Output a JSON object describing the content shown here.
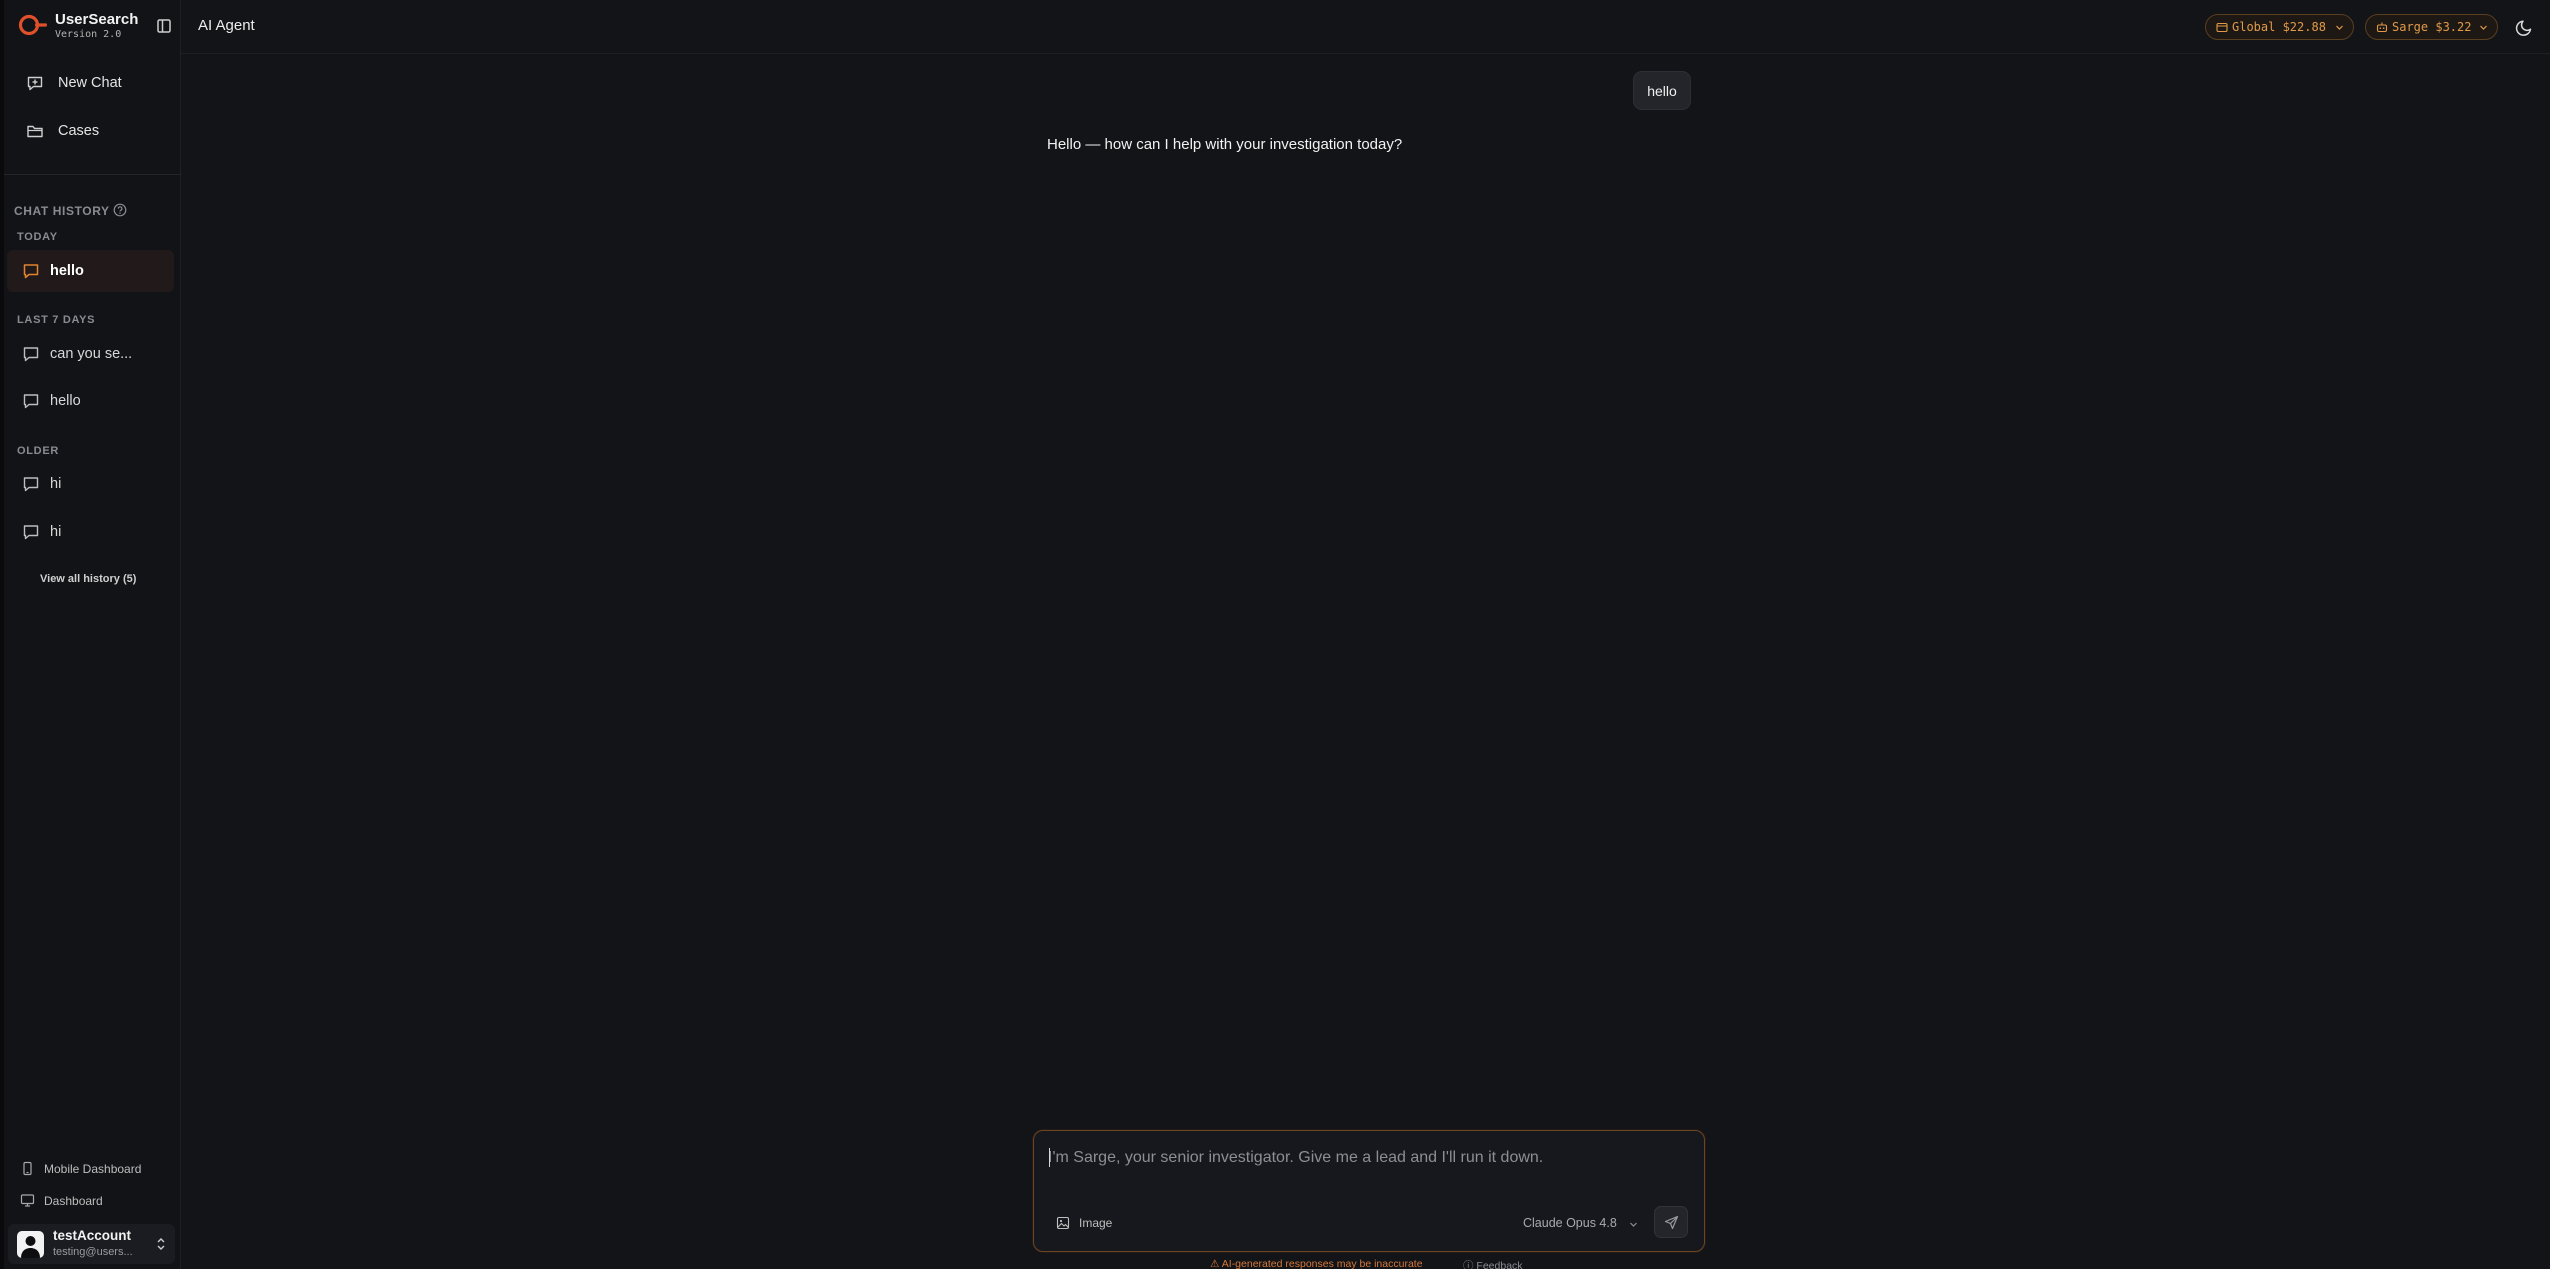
{
  "brand": {
    "name": "UserSearch",
    "version": "Version 2.0",
    "accent_color": "#e0502a"
  },
  "header": {
    "title": "AI Agent",
    "global_balance": "Global $22.88",
    "agent_balance": "Sarge $3.22",
    "pill_color": "#e09a4a"
  },
  "sidebar": {
    "nav": {
      "new_chat": "New Chat",
      "cases": "Cases"
    },
    "history_title": "CHAT HISTORY",
    "groups": {
      "today": "TODAY",
      "last7": "LAST 7 DAYS",
      "older": "OLDER"
    },
    "history": {
      "today": [
        {
          "label": "hello",
          "active": true
        }
      ],
      "last7": [
        {
          "label": "can you se..."
        },
        {
          "label": "hello"
        }
      ],
      "older": [
        {
          "label": "hi"
        },
        {
          "label": "hi"
        }
      ]
    },
    "view_all": "View all history (5)",
    "footer_links": {
      "mobile_dashboard": "Mobile Dashboard",
      "dashboard": "Dashboard"
    },
    "user": {
      "name": "testAccount",
      "email": "testing@users..."
    }
  },
  "conversation": {
    "user_message": "hello",
    "assistant_message": "Hello — how can I help with your investigation today?"
  },
  "composer": {
    "placeholder": "I'm Sarge, your senior investigator. Give me a lead and I'll run it down.",
    "value": "",
    "image_label": "Image",
    "model": "Claude Opus 4.8"
  },
  "footer": {
    "disclaimer": "AI-generated responses may be inaccurate",
    "feedback": "Feedback"
  },
  "icons": {
    "logo": "usersearch-logo-icon",
    "sidebar_toggle": "sidebar-toggle-icon",
    "new_chat": "message-plus-icon",
    "cases": "folder-icon",
    "help": "help-circle-icon",
    "chat": "message-square-icon",
    "mobile": "smartphone-icon",
    "desktop": "monitor-icon",
    "theme": "moon-icon",
    "image": "image-icon",
    "send": "send-icon"
  }
}
